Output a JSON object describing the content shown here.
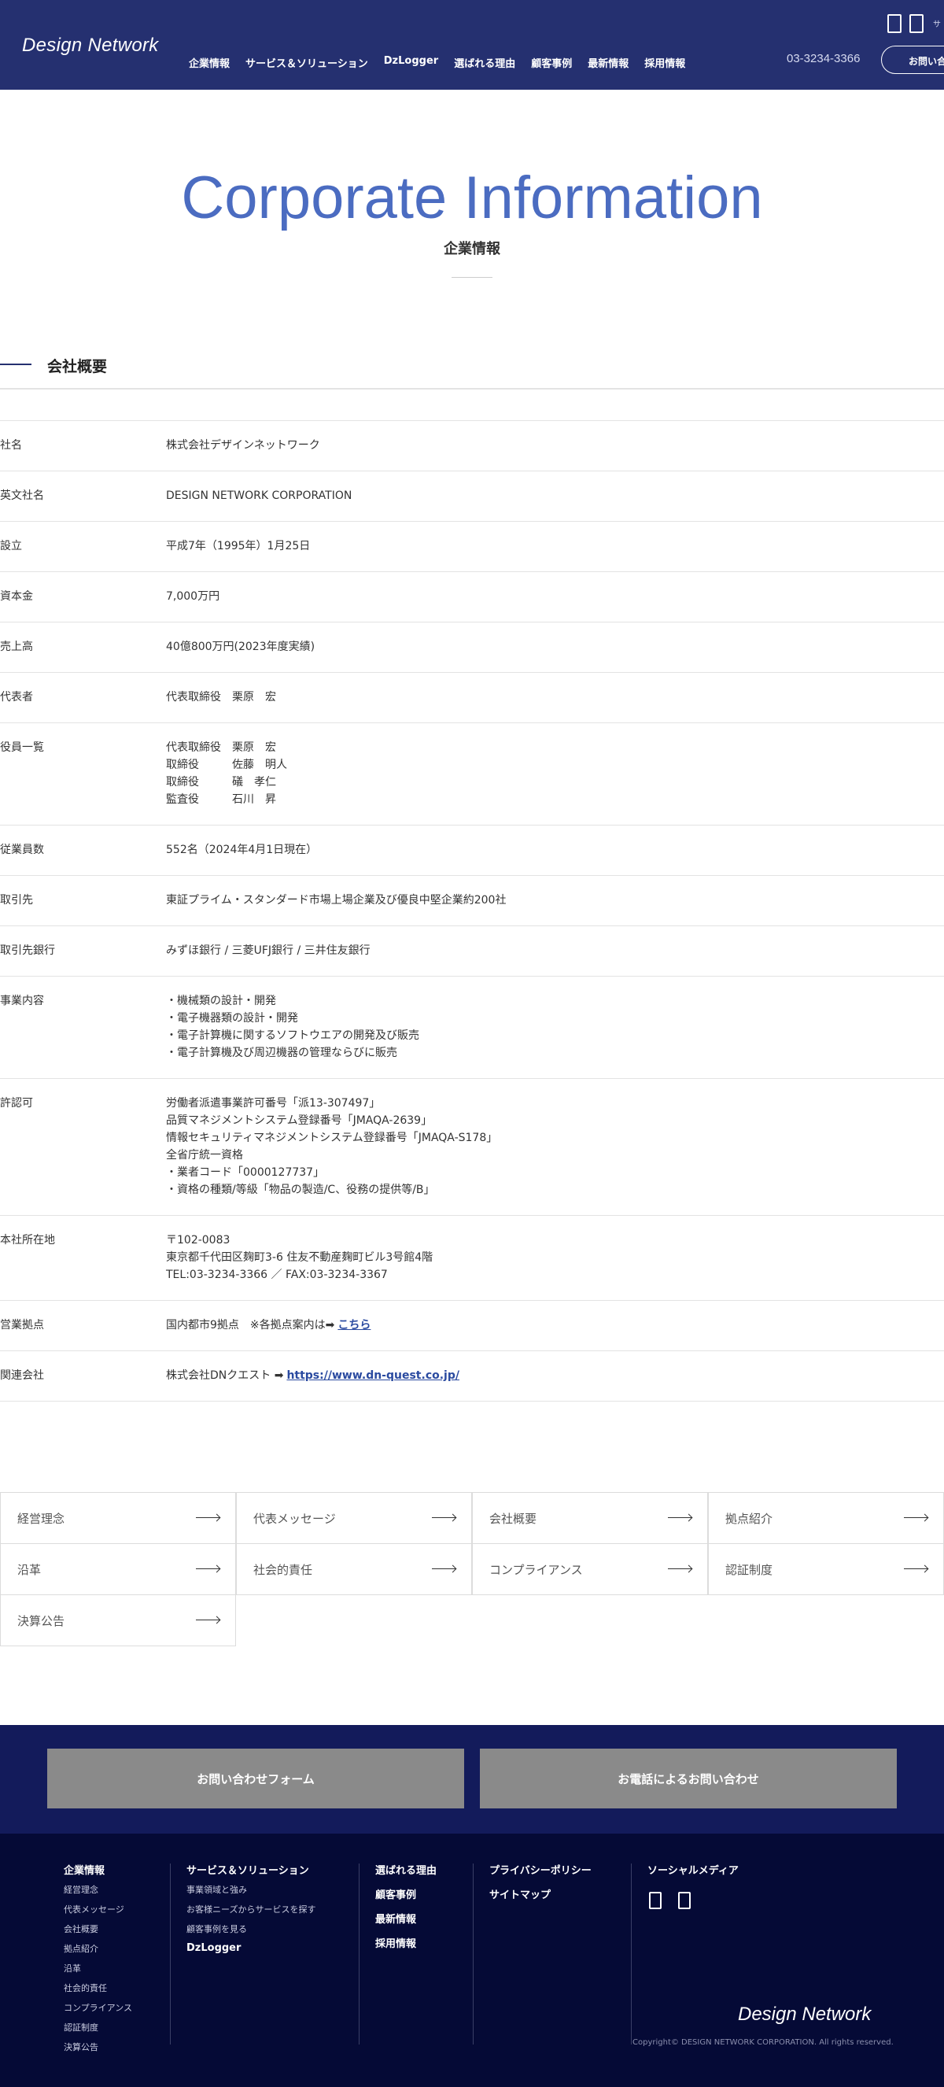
{
  "header": {
    "logo": "Design Network",
    "nav": [
      "企業情報",
      "サービス＆ソリューション",
      "DzLogger",
      "選ばれる理由",
      "顧客事例",
      "最新情報",
      "採用情報"
    ],
    "phone": "03-3234-3366",
    "small_text": "サ",
    "contact_button": "お問い合"
  },
  "hero": {
    "title_en": "Corporate Information",
    "title_ja": "企業情報"
  },
  "section": {
    "title": "会社概要"
  },
  "company_info": [
    {
      "label": "社名",
      "lines": [
        "株式会社デザインネットワーク"
      ]
    },
    {
      "label": "英文社名",
      "lines": [
        "DESIGN NETWORK CORPORATION"
      ]
    },
    {
      "label": "設立",
      "lines": [
        "平成7年（1995年）1月25日"
      ]
    },
    {
      "label": "資本金",
      "lines": [
        "7,000万円"
      ]
    },
    {
      "label": "売上高",
      "lines": [
        "40億800万円(2023年度実績)"
      ]
    },
    {
      "label": "代表者",
      "lines": [
        "代表取締役　栗原　宏"
      ]
    },
    {
      "label": "役員一覧",
      "lines": [
        "代表取締役　栗原　宏",
        "取締役　　　佐藤　明人",
        "取締役　　　礒　孝仁",
        "監査役　　　石川　昇"
      ]
    },
    {
      "label": "従業員数",
      "lines": [
        "552名（2024年4月1日現在）"
      ]
    },
    {
      "label": "取引先",
      "lines": [
        "東証プライム・スタンダード市場上場企業及び優良中堅企業約200社"
      ]
    },
    {
      "label": "取引先銀行",
      "lines": [
        "みずほ銀行 / 三菱UFJ銀行 / 三井住友銀行"
      ]
    },
    {
      "label": "事業内容",
      "lines": [
        "・機械類の設計・開発",
        "・電子機器類の設計・開発",
        "・電子計算機に関するソフトウエアの開発及び販売",
        "・電子計算機及び周辺機器の管理ならびに販売"
      ]
    },
    {
      "label": "許認可",
      "lines": [
        "労働者派遣事業許可番号「派13-307497」",
        "品質マネジメントシステム登録番号「JMAQA-2639」",
        "情報セキュリティマネジメントシステム登録番号「JMAQA-S178」",
        "全省庁統一資格",
        "・業者コード「0000127737」",
        "・資格の種類/等級「物品の製造/C、役務の提供等/B」"
      ]
    },
    {
      "label": "本社所在地",
      "lines": [
        "〒102-0083",
        "東京都千代田区麹町3-6 住友不動産麹町ビル3号館4階",
        "TEL:03-3234-3366 ／ FAX:03-3234-3367"
      ]
    }
  ],
  "branches": {
    "label": "営業拠点",
    "text": "国内都市9拠点　※各拠点案内は➡",
    "link": "こちら"
  },
  "affiliate": {
    "label": "関連会社",
    "text": "株式会社DNクエスト ➡",
    "link": "https://www.dn-quest.co.jp/"
  },
  "links": [
    "経営理念",
    "代表メッセージ",
    "会社概要",
    "拠点紹介",
    "沿革",
    "社会的責任",
    "コンプライアンス",
    "認証制度",
    "決算公告"
  ],
  "cta": {
    "form": "お問い合わせフォーム",
    "phone": "お電話によるお問い合わせ"
  },
  "footer": {
    "col1": {
      "title": "企業情報",
      "items": [
        "経営理念",
        "代表メッセージ",
        "会社概要",
        "拠点紹介",
        "沿革",
        "社会的責任",
        "コンプライアンス",
        "認証制度",
        "決算公告"
      ]
    },
    "col2": {
      "title": "サービス＆ソリューション",
      "items": [
        "事業領域と強み",
        "お客様ニーズからサービスを探す",
        "顧客事例を見る"
      ],
      "extra": "DzLogger"
    },
    "col3": {
      "items": [
        "選ばれる理由",
        "顧客事例",
        "最新情報",
        "採用情報"
      ]
    },
    "col4": {
      "items": [
        "プライバシーポリシー",
        "サイトマップ"
      ]
    },
    "col5": {
      "title": "ソーシャルメディア"
    },
    "logo": "Design Network",
    "copyright": "Copyright© DESIGN NETWORK CORPORATION. All rights reserved."
  },
  "icons": [
    "facebook-icon",
    "x-icon"
  ]
}
